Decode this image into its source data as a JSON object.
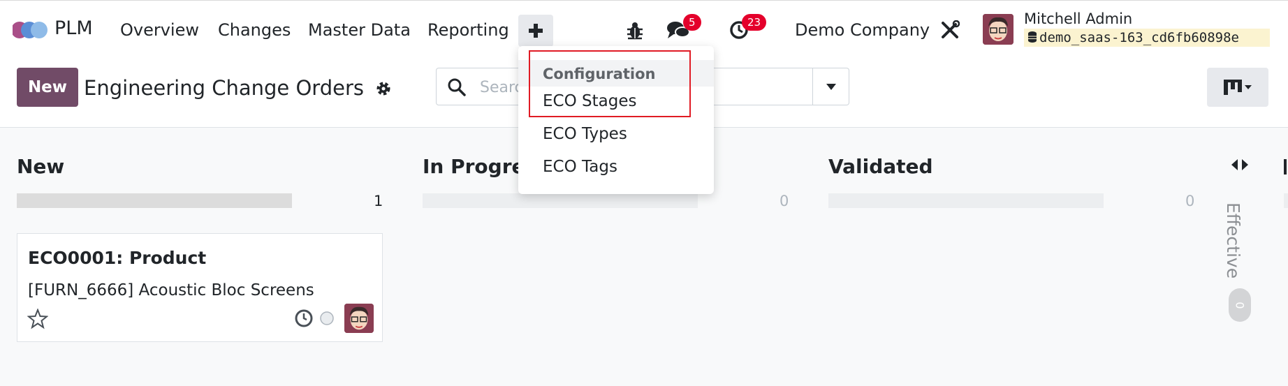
{
  "app": {
    "name": "PLM"
  },
  "nav": {
    "items": [
      "Overview",
      "Changes",
      "Master Data",
      "Reporting"
    ]
  },
  "systray": {
    "messages_badge": "5",
    "activities_badge": "23",
    "company": "Demo Company",
    "user_name": "Mitchell Admin",
    "db_name": "demo_saas-163_cd6fb60898e"
  },
  "control": {
    "new_label": "New",
    "title": "Engineering Change Orders",
    "search_placeholder": "Search..."
  },
  "dropdown": {
    "header": "Configuration",
    "items": [
      "ECO Stages",
      "ECO Types",
      "ECO Tags"
    ]
  },
  "kanban": {
    "columns": [
      {
        "title": "New",
        "count": "1",
        "progress": 1
      },
      {
        "title": "In Progress",
        "count": "0",
        "progress": 0
      },
      {
        "title": "Validated",
        "count": "0",
        "progress": 0
      }
    ],
    "folded": {
      "title": "Effective",
      "count": "0"
    },
    "card": {
      "title": "ECO0001: Product",
      "subtitle": "[FURN_6666] Acoustic Bloc Screens"
    }
  },
  "colors": {
    "brand": "#714b67",
    "badge": "#e4002b",
    "highlight": "#e01b24"
  }
}
